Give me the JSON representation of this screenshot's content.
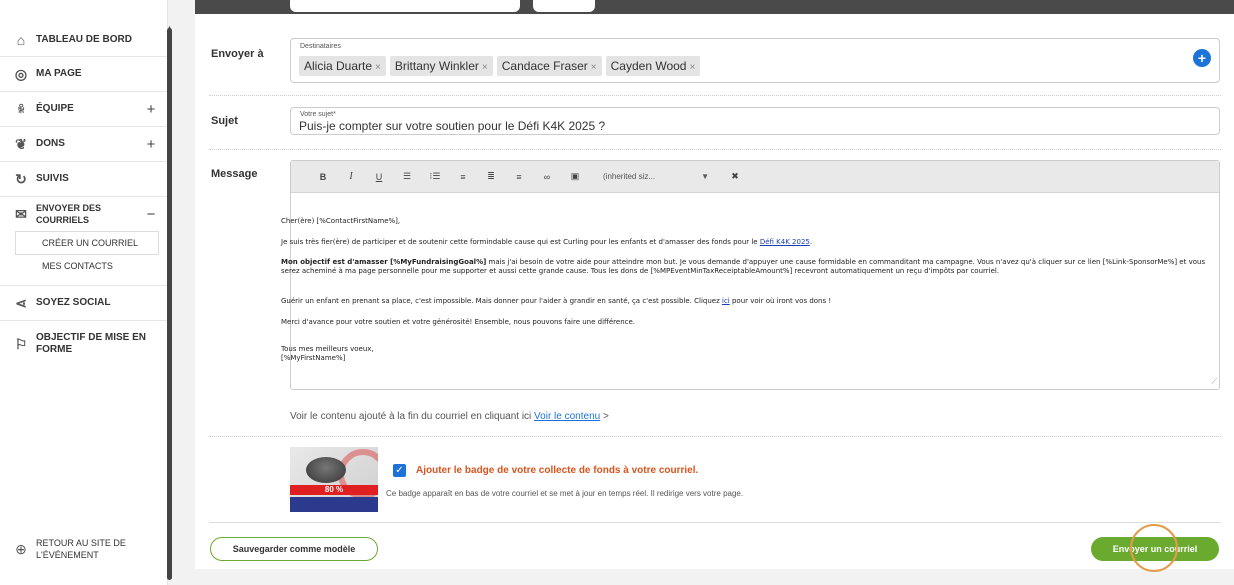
{
  "sidebar": {
    "items": [
      {
        "label": "TABLEAU DE BORD",
        "icon": "home-icon"
      },
      {
        "label": "MA PAGE",
        "icon": "user-icon"
      },
      {
        "label": "ÉQUIPE",
        "icon": "team-icon",
        "toggle": "+"
      },
      {
        "label": "DONS",
        "icon": "donation-icon",
        "toggle": "+"
      },
      {
        "label": "SUIVIS",
        "icon": "refresh-icon"
      },
      {
        "label": "ENVOYER DES COURRIELS",
        "icon": "mail-icon",
        "toggle": "−"
      },
      {
        "label": "SOYEZ SOCIAL",
        "icon": "share-icon"
      },
      {
        "label": "OBJECTIF DE MISE EN FORME",
        "icon": "flag-icon"
      },
      {
        "label": "RETOUR AU SITE DE L'ÉVÉNEMENT",
        "icon": "globe-icon"
      }
    ],
    "subitems": [
      "CRÉER UN COURRIEL",
      "MES CONTACTS"
    ]
  },
  "form": {
    "to_label": "Envoyer à",
    "recipients_caption": "Destinataires",
    "recipients": [
      "Alicia Duarte",
      "Brittany Winkler",
      "Candace Fraser",
      "Cayden Wood"
    ],
    "chip_remove": "×",
    "add_button": "+",
    "subject_label": "Sujet",
    "subject_caption": "Votre sujet*",
    "subject_value": "Puis-je compter sur votre soutien pour le Défi K4K 2025 ?",
    "message_label": "Message"
  },
  "toolbar": {
    "bold": "B",
    "italic": "I",
    "underline": "U",
    "font_size": "(inherited siz...",
    "dropdown_arrow": "▼"
  },
  "message": {
    "greeting": "Cher(ère) [%ContactFirstName%],",
    "p1_text": "Je suis très fier(ère) de participer et de soutenir cette formindable cause qui est Curling pour les enfants et d'amasser des fonds pour le ",
    "p1_link": "Défi K4K 2025",
    "p1_end": ".",
    "p2_bold": "Mon objectif est d'amasser [%MyFundraisingGoal%]",
    "p2_text": " mais j'ai besoin de votre aide pour atteindre mon but. Je vous demande d'appuyer une cause formidable en commanditant ma campagne. Vous n'avez qu'à cliquer sur ce lien [%Link-SponsorMe%] et vous serez acheminé à ma page personnelle pour me supporter et aussi cette grande cause. Tous les dons de [%MPEventMinTaxReceiptableAmount%] recevront automatiquement un reçu d'impôts par courriel.",
    "p3_text": "Guérir un enfant en prenant sa place, c'est impossible. Mais donner pour l'aider à grandir en santé, ça c'est possible. Cliquez ",
    "p3_link": "ici",
    "p3_end": " pour voir où iront vos dons !",
    "p4": "Merci d'avance pour votre soutien et votre générosité! Ensemble, nous pouvons faire une différence.",
    "closing": "Tous mes meilleurs voeux,",
    "signature": "[%MyFirstName%]"
  },
  "content_note": {
    "text": "Voir le contenu ajouté à la fin du courriel en cliquant ici ",
    "link": "Voir le contenu",
    "arrow": " >"
  },
  "badge": {
    "percent": "80 %",
    "checked": true,
    "title": "Ajouter le badge de votre collecte de fonds à votre courriel.",
    "description": "Ce badge apparaît en bas de votre courriel et se met à jour en temps réel. Il redirige vers votre page."
  },
  "actions": {
    "save_template": "Sauvegarder comme modèle",
    "send": "Envoyer un courriel"
  },
  "colors": {
    "accent_blue": "#1e73d8",
    "green": "#6aab2f",
    "orange": "#d9541e"
  }
}
